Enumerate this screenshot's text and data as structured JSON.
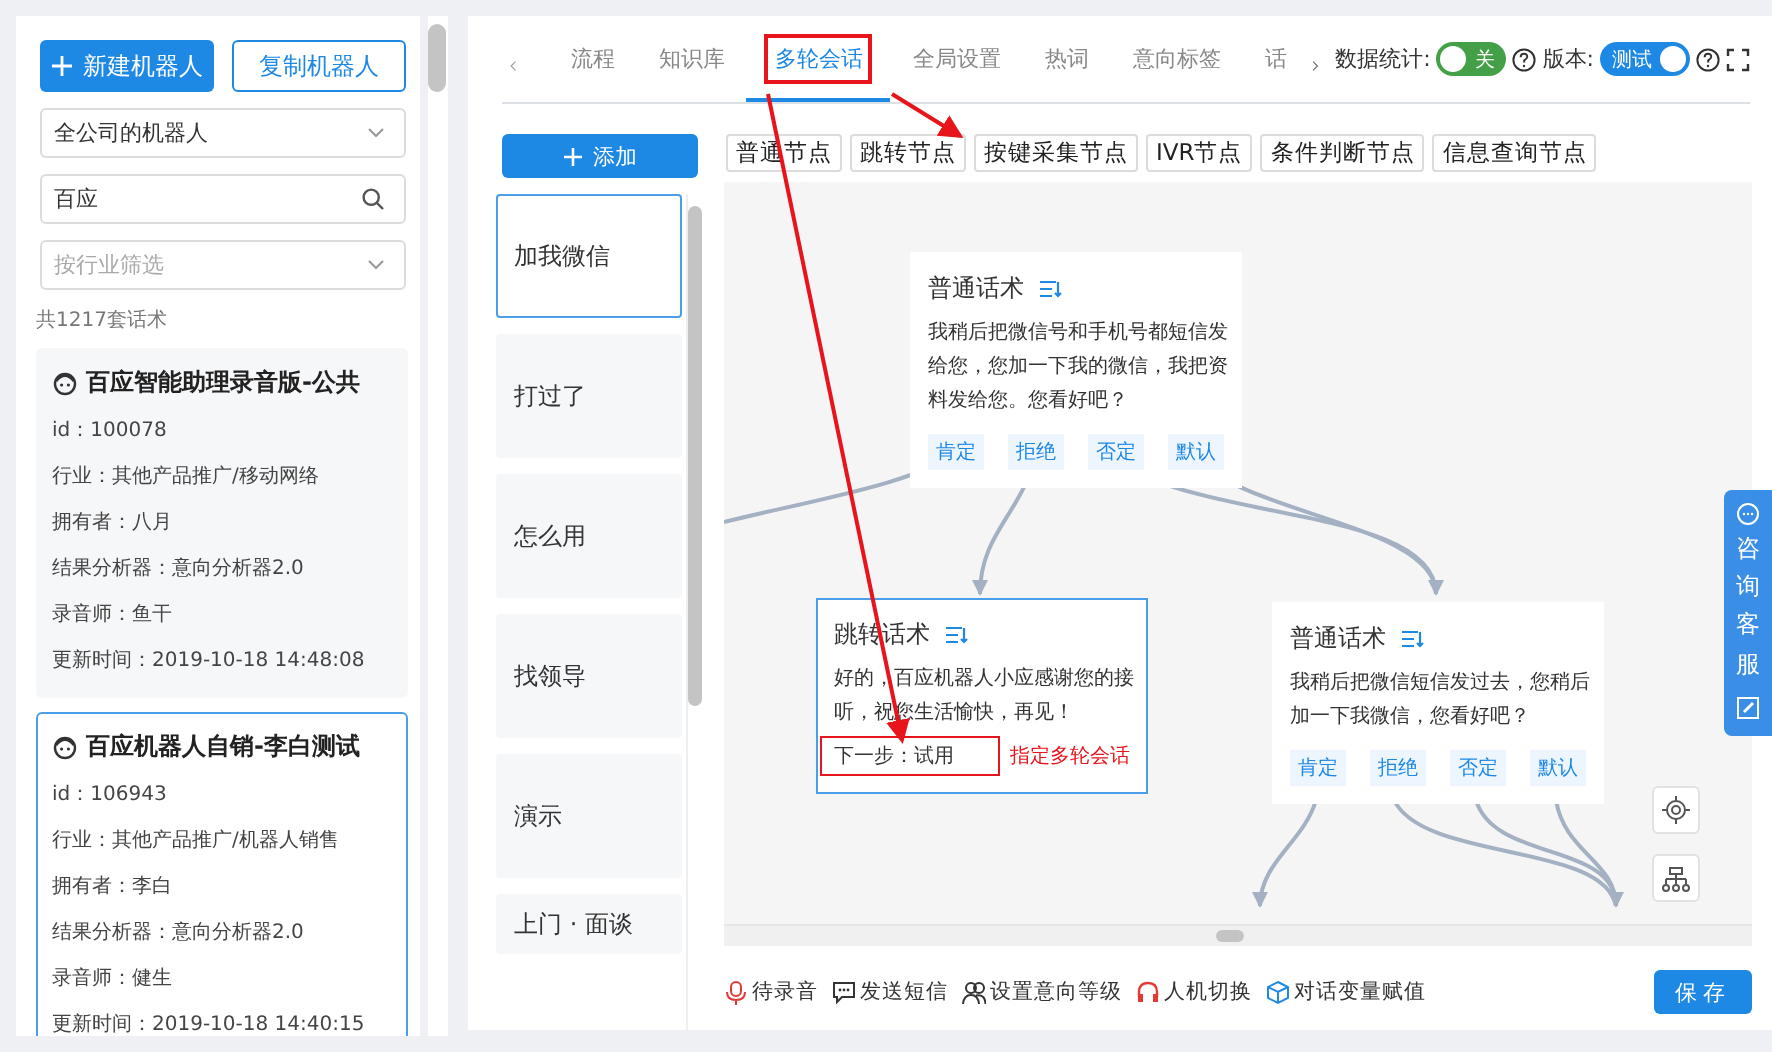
{
  "sidebar": {
    "buttons": [
      {
        "label": "新建机器人",
        "kind": "primary"
      },
      {
        "label": "复制机器人",
        "kind": "outline"
      }
    ],
    "scope_select": {
      "value": "全公司的机器人"
    },
    "search": {
      "value": "百应"
    },
    "industry_filter": {
      "placeholder": "按行业筛选"
    },
    "count": "共1217套话术",
    "cards": [
      {
        "title": "百应智能助理录音版-公共",
        "selected": false,
        "fields": [
          "id：100078",
          "行业：其他产品推广/移动网络",
          "拥有者：八月",
          "结果分析器：意向分析器2.0",
          "录音师：鱼干",
          "更新时间：2019-10-18 14:48:08"
        ]
      },
      {
        "title": "百应机器人自销-李白测试",
        "selected": true,
        "fields": [
          "id：106943",
          "行业：其他产品推广/机器人销售",
          "拥有者：李白",
          "结果分析器：意向分析器2.0",
          "录音师：健生",
          "更新时间：2019-10-18 14:40:15"
        ]
      }
    ]
  },
  "tabs": [
    {
      "label": "流程",
      "selected": false
    },
    {
      "label": "知识库",
      "selected": false
    },
    {
      "label": "多轮会话",
      "selected": true
    },
    {
      "label": "全局设置",
      "selected": false
    },
    {
      "label": "热词",
      "selected": false
    },
    {
      "label": "意向标签",
      "selected": false
    },
    {
      "label": "话",
      "selected": false
    }
  ],
  "header_controls": [
    {
      "label": "数据统计:",
      "on": false,
      "text": "关",
      "color": "#43a047"
    },
    {
      "label": "版本:",
      "on": true,
      "text": "测试",
      "color": "#1e88e5"
    }
  ],
  "add_button": "添加",
  "intents": [
    {
      "label": "加我微信",
      "selected": true
    },
    {
      "label": "打过了",
      "selected": false
    },
    {
      "label": "怎么用",
      "selected": false
    },
    {
      "label": "找领导",
      "selected": false
    },
    {
      "label": "演示",
      "selected": false
    },
    {
      "label": "上门 · 面谈",
      "selected": false
    }
  ],
  "node_types": [
    "普通节点",
    "跳转节点",
    "按键采集节点",
    "IVR节点",
    "条件判断节点",
    "信息查询节点"
  ],
  "nodes": [
    {
      "kind": "normal",
      "title": "普通话术",
      "text": "我稍后把微信号和手机号都短信发给您，您加一下我的微信，我把资料发给您。您看好吧？",
      "branches": [
        "肯定",
        "拒绝",
        "否定",
        "默认"
      ],
      "selected": false
    },
    {
      "kind": "jump",
      "title": "跳转话术",
      "text": "好的，百应机器人小应感谢您的接听，祝您生活愉快，再见！",
      "next": "下一步：试用",
      "selected": true
    },
    {
      "kind": "normal",
      "title": "普通话术",
      "text": "我稍后把微信短信发过去，您稍后加一下我微信，您看好吧？",
      "branches": [
        "肯定",
        "拒绝",
        "否定",
        "默认"
      ],
      "selected": false
    }
  ],
  "annotation": "指定多轮会话",
  "actions": [
    {
      "kind": "record",
      "label": "待录音"
    },
    {
      "kind": "sms",
      "label": "发送短信"
    },
    {
      "kind": "intent",
      "label": "设置意向等级"
    },
    {
      "kind": "handoff",
      "label": "人机切换"
    },
    {
      "kind": "variable",
      "label": "对话变量赋值"
    }
  ],
  "save_button": "保存",
  "support_float": "咨询客服"
}
